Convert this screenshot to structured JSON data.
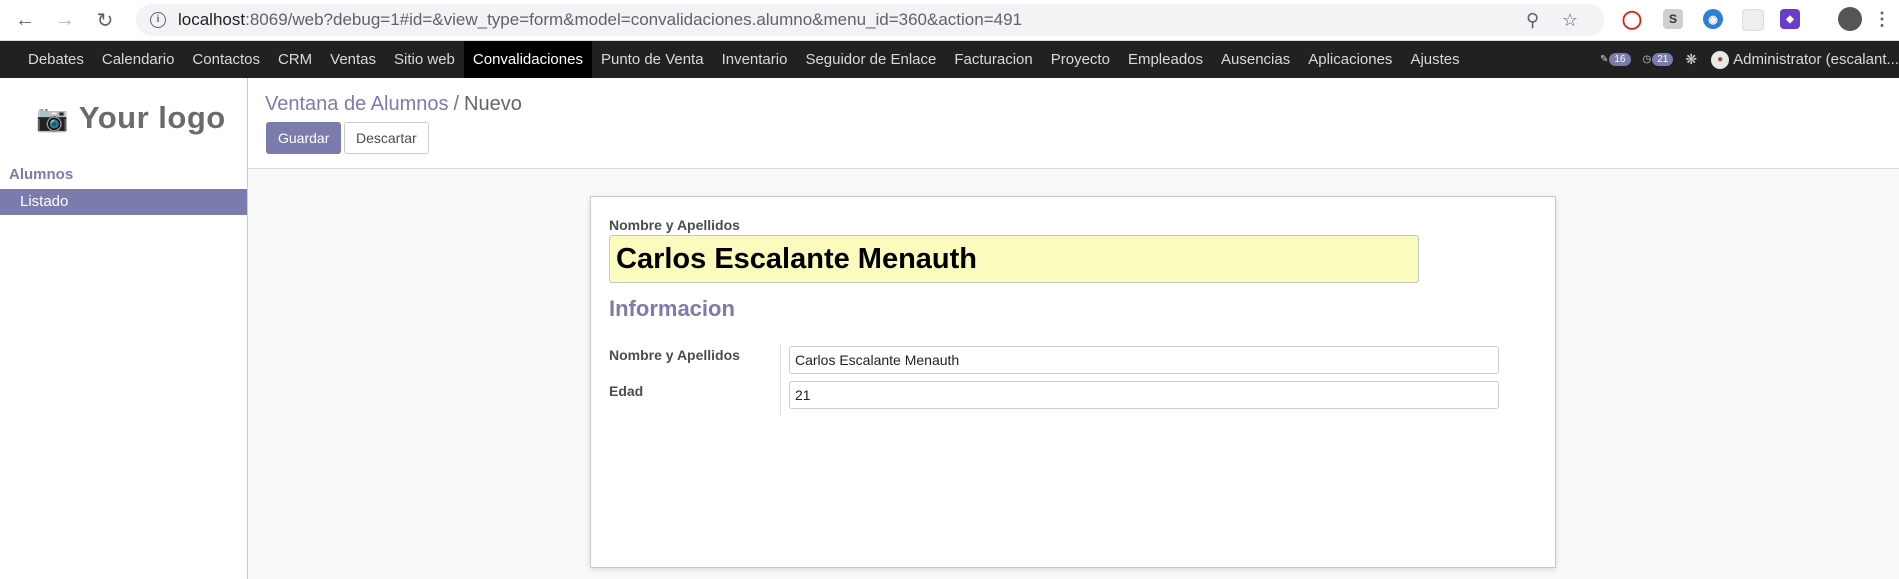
{
  "browser": {
    "url_host": "localhost",
    "url_rest": ":8069/web?debug=1#id=&view_type=form&model=convalidaciones.alumno&menu_id=360&action=491",
    "icons": [
      "back-icon",
      "forward-icon",
      "reload-icon",
      "info-icon",
      "zoom-out-icon",
      "star-icon"
    ]
  },
  "topbar": {
    "menu": [
      "Debates",
      "Calendario",
      "Contactos",
      "CRM",
      "Ventas",
      "Sitio web",
      "Convalidaciones",
      "Punto de Venta",
      "Inventario",
      "Seguidor de Enlace",
      "Facturacion",
      "Proyecto",
      "Empleados",
      "Ausencias",
      "Aplicaciones",
      "Ajustes"
    ],
    "active": "Convalidaciones",
    "messages_count": "16",
    "activities_count": "21",
    "user": "Administrator (escalant..."
  },
  "sidebar": {
    "logo_text": "Your logo",
    "section": "Alumnos",
    "items": [
      "Listado"
    ]
  },
  "control": {
    "breadcrumb_parent": "Ventana de Alumnos",
    "breadcrumb_separator": "/",
    "breadcrumb_current": "Nuevo",
    "save_label": "Guardar",
    "discard_label": "Descartar"
  },
  "form": {
    "title_label": "Nombre y Apellidos",
    "title_value": "Carlos Escalante Menauth",
    "section_title": "Informacion",
    "fields": [
      {
        "label": "Nombre y Apellidos",
        "value": "Carlos Escalante Menauth"
      },
      {
        "label": "Edad",
        "value": "21"
      }
    ]
  },
  "colors": {
    "brand": "#7c7bad",
    "topbar": "#212121",
    "title_field_bg": "#fbfbbe"
  }
}
